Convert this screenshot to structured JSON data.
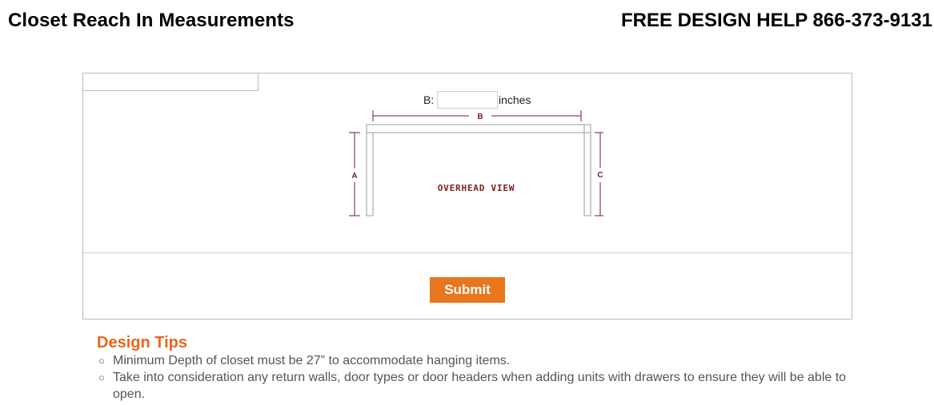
{
  "header": {
    "title": "Closet Reach In Measurements",
    "help": "FREE DESIGN HELP 866-373-9131"
  },
  "form": {
    "field_label": "B:",
    "field_value": "",
    "unit": "inches",
    "submit_label": "Submit"
  },
  "diagram": {
    "label_a": "A",
    "label_b": "B",
    "label_c": "C",
    "caption": "OVERHEAD VIEW",
    "line_color": "#7a1e1e",
    "wall_color": "#9a9a9a"
  },
  "tips": {
    "title": "Design Tips",
    "items": [
      "Minimum Depth of closet must be 27” to accommodate hanging items.",
      "Take into consideration any return walls, door types or door headers when adding units with drawers to ensure they will be able to open."
    ]
  },
  "colors": {
    "accent": "#e8761e",
    "tips_title": "#e8661e"
  }
}
